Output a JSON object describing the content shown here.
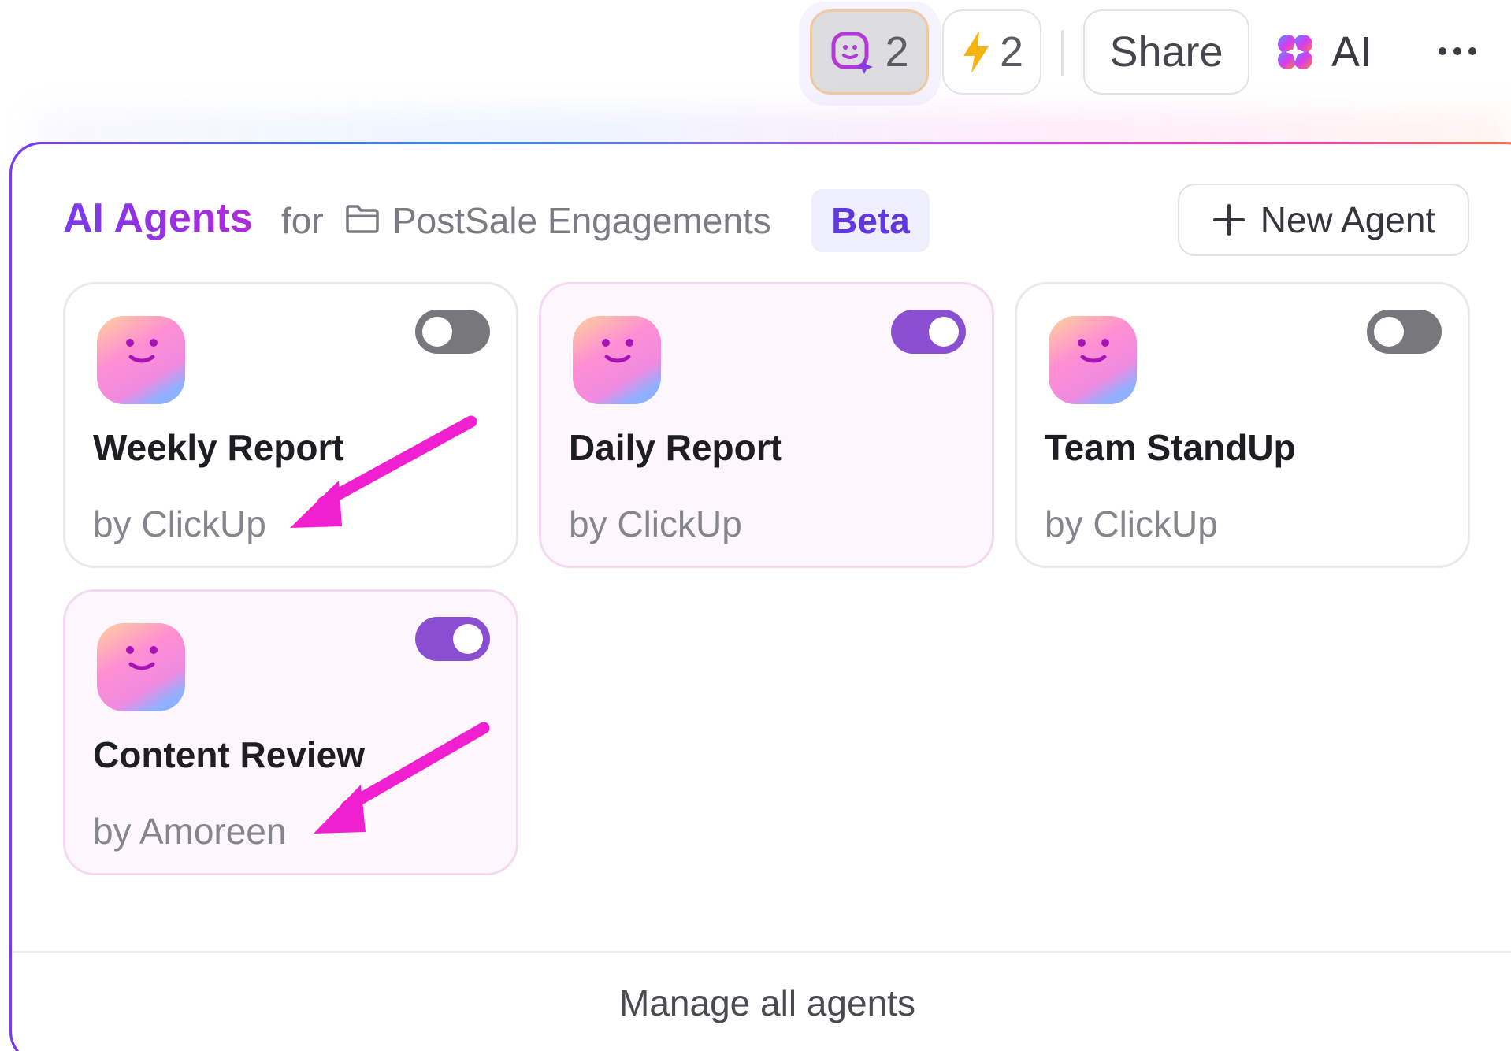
{
  "toolbar": {
    "agents_count": "2",
    "automations_count": "2",
    "share_label": "Share",
    "ai_label": "AI"
  },
  "panel": {
    "title": "AI Agents",
    "for_label": "for",
    "folder_name": "PostSale Engagements",
    "beta_label": "Beta",
    "new_agent_label": "New Agent",
    "manage_label": "Manage all agents"
  },
  "agents": [
    {
      "name": "Weekly Report",
      "author": "by ClickUp",
      "enabled": false
    },
    {
      "name": "Daily Report",
      "author": "by ClickUp",
      "enabled": true
    },
    {
      "name": "Team StandUp",
      "author": "by ClickUp",
      "enabled": false
    },
    {
      "name": "Content Review",
      "author": "by Amoreen",
      "enabled": true
    }
  ],
  "colors": {
    "brand_purple": "#7c3aed",
    "toggle_on": "#8a4fd1",
    "toggle_off": "#77777c",
    "annotation_arrow": "#f020d0"
  }
}
